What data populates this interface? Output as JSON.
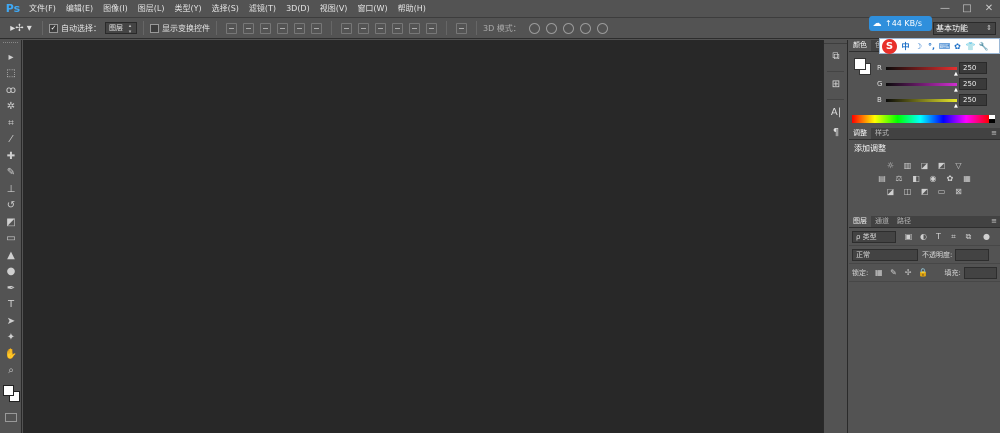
{
  "app": {
    "logo": "Ps"
  },
  "menu": [
    "文件(F)",
    "编辑(E)",
    "图像(I)",
    "图层(L)",
    "类型(Y)",
    "选择(S)",
    "滤镜(T)",
    "3D(D)",
    "视图(V)",
    "窗口(W)",
    "帮助(H)"
  ],
  "window_controls": {
    "minimize": "—",
    "maximize": "□",
    "close": "✕"
  },
  "options": {
    "tool_icon": "move-tool-icon",
    "auto_select_label": "自动选择：",
    "auto_select_checked": true,
    "auto_select_value": "图层",
    "show_transform_label": "显示变换控件",
    "show_transform_checked": false,
    "mode_3d_label": "3D 模式："
  },
  "network": {
    "speed": "↑44 KB/s"
  },
  "workspace": {
    "value": "基本功能"
  },
  "ime": {
    "items": [
      "中",
      "☽",
      "°,",
      "⌨",
      "✿",
      "👕",
      "🔧"
    ]
  },
  "color_panel": {
    "tabs": [
      "颜色",
      "色板"
    ],
    "r": {
      "label": "R",
      "value": "250"
    },
    "g": {
      "label": "G",
      "value": "250"
    },
    "b": {
      "label": "B",
      "value": "250"
    },
    "colors": {
      "r_track": "#e63030",
      "g_track": "#d12fd1",
      "b_track": "#e8e82c"
    }
  },
  "adjust_panel": {
    "tabs": [
      "调整",
      "样式"
    ],
    "title": "添加调整"
  },
  "layers_panel": {
    "tabs": [
      "图层",
      "通道",
      "路径"
    ],
    "filter_label": "ρ 类型",
    "blend_mode": "正常",
    "opacity_label": "不透明度:",
    "lock_label": "锁定:",
    "fill_label": "填充:"
  }
}
